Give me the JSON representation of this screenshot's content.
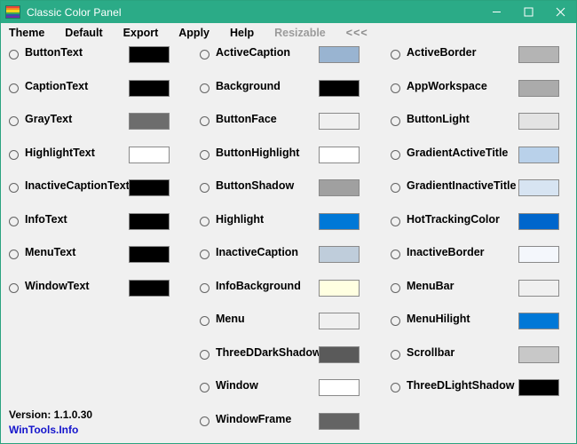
{
  "window": {
    "title": "Classic Color Panel",
    "titlebar_color": "#2bab87",
    "border_color": "#2aa37f",
    "background_color": "#f0f0f0",
    "icon": "rainbow-flag-icon",
    "icon_stripes": [
      "#e8453c",
      "#f18a21",
      "#f4d31c",
      "#3aa757",
      "#2c56a8",
      "#6f2da8"
    ],
    "controls": [
      {
        "name": "minimize",
        "glyph": "minimize-icon"
      },
      {
        "name": "maximize",
        "glyph": "maximize-icon"
      },
      {
        "name": "close",
        "glyph": "close-icon"
      }
    ]
  },
  "menubar": {
    "items": [
      {
        "label": "Theme",
        "state": "enabled"
      },
      {
        "label": "Default",
        "state": "enabled"
      },
      {
        "label": "Export",
        "state": "enabled"
      },
      {
        "label": "Apply",
        "state": "enabled"
      },
      {
        "label": "Help",
        "state": "enabled"
      },
      {
        "label": "Resizable",
        "state": "disabled"
      },
      {
        "label": "<<<",
        "state": "arrows"
      }
    ]
  },
  "columns": [
    {
      "name": "column-1",
      "rows": [
        {
          "label": "ButtonText",
          "color": "#000000"
        },
        {
          "label": "CaptionText",
          "color": "#000000"
        },
        {
          "label": "GrayText",
          "color": "#6d6d6d"
        },
        {
          "label": "HighlightText",
          "color": "#ffffff"
        },
        {
          "label": "InactiveCaptionText",
          "color": "#000000"
        },
        {
          "label": "InfoText",
          "color": "#000000"
        },
        {
          "label": "MenuText",
          "color": "#000000"
        },
        {
          "label": "WindowText",
          "color": "#000000"
        }
      ]
    },
    {
      "name": "column-2",
      "rows": [
        {
          "label": "ActiveCaption",
          "color": "#99b4d1"
        },
        {
          "label": "Background",
          "color": "#000000"
        },
        {
          "label": "ButtonFace",
          "color": "#f0f0f0"
        },
        {
          "label": "ButtonHighlight",
          "color": "#ffffff"
        },
        {
          "label": "ButtonShadow",
          "color": "#a0a0a0"
        },
        {
          "label": "Highlight",
          "color": "#0078d7"
        },
        {
          "label": "InactiveCaption",
          "color": "#bfcddb"
        },
        {
          "label": "InfoBackground",
          "color": "#ffffe1"
        },
        {
          "label": "Menu",
          "color": "#f0f0f0"
        },
        {
          "label": "ThreeDDarkShadow",
          "color": "#5a5a5a"
        },
        {
          "label": "Window",
          "color": "#ffffff"
        },
        {
          "label": "WindowFrame",
          "color": "#646464"
        }
      ]
    },
    {
      "name": "column-3",
      "rows": [
        {
          "label": "ActiveBorder",
          "color": "#b4b4b4"
        },
        {
          "label": "AppWorkspace",
          "color": "#ababab"
        },
        {
          "label": "ButtonLight",
          "color": "#e3e3e3"
        },
        {
          "label": "GradientActiveTitle",
          "color": "#b9d1ea"
        },
        {
          "label": "GradientInactiveTitle",
          "color": "#d7e4f2"
        },
        {
          "label": "HotTrackingColor",
          "color": "#0066cc"
        },
        {
          "label": "InactiveBorder",
          "color": "#f4f7fc"
        },
        {
          "label": "MenuBar",
          "color": "#f0f0f0"
        },
        {
          "label": "MenuHilight",
          "color": "#0078d7"
        },
        {
          "label": "Scrollbar",
          "color": "#c8c8c8"
        },
        {
          "label": "ThreeDLightShadow",
          "color": "#000000"
        }
      ]
    }
  ],
  "footer": {
    "version": "Version: 1.1.0.30",
    "link": "WinTools.Info",
    "link_color": "#1414cc"
  }
}
